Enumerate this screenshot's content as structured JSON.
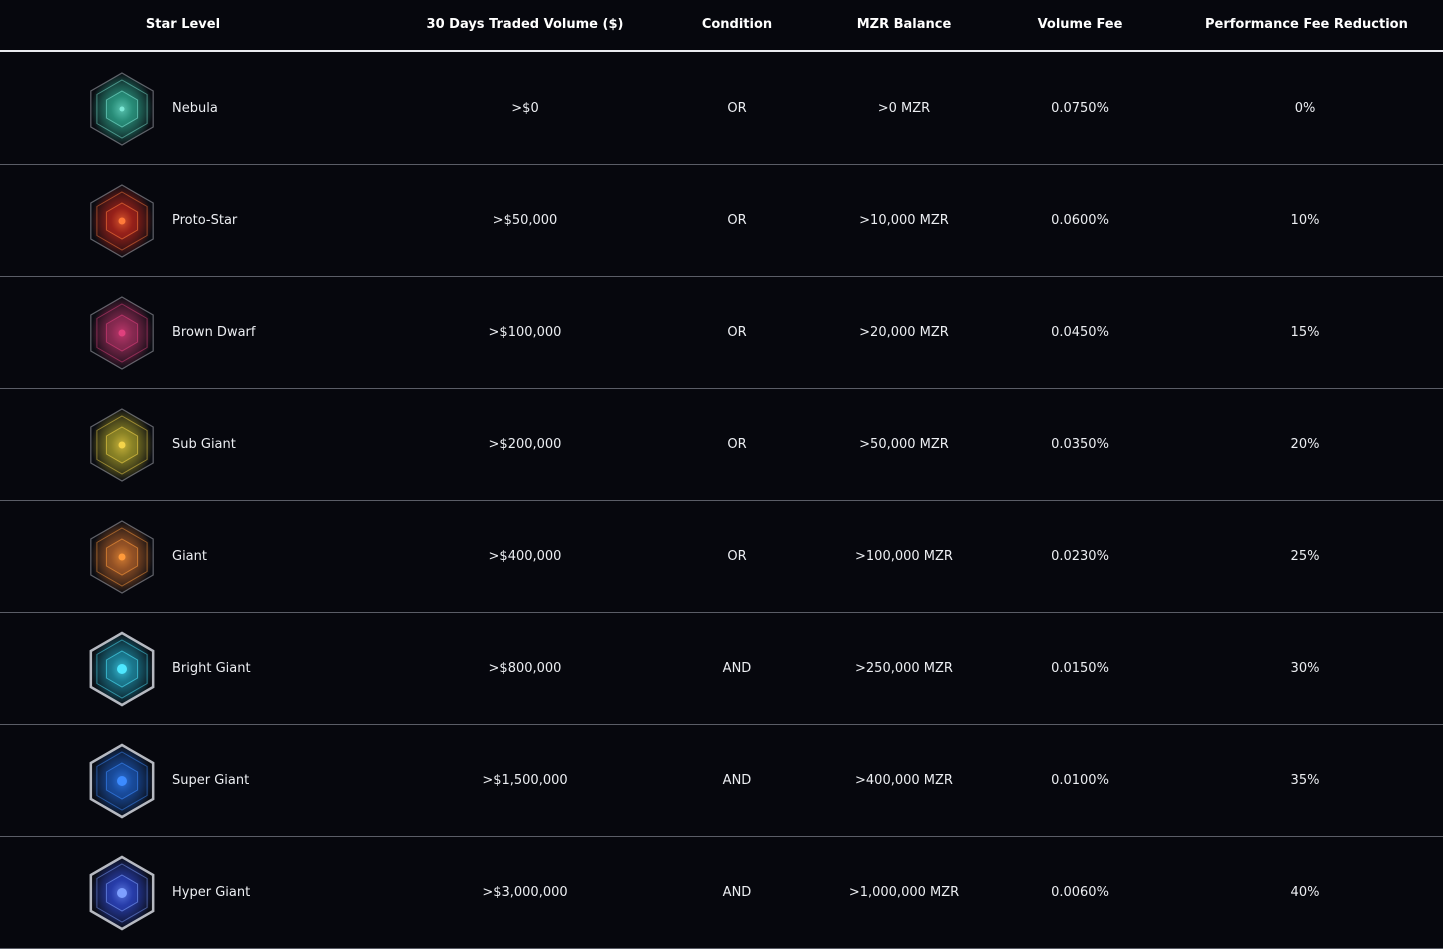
{
  "columns": {
    "star_level": "Star Level",
    "volume": "30 Days Traded Volume ($)",
    "condition": "Condition",
    "mzr_balance": "MZR Balance",
    "volume_fee": "Volume Fee",
    "perf_reduction": "Performance Fee Reduction"
  },
  "rows": [
    {
      "name": "Nebula",
      "volume": ">$0",
      "condition": "OR",
      "mzr": ">0 MZR",
      "fee": "0.0750%",
      "perf": "0%",
      "icon": "nebula-hexagon-icon",
      "color": "#2fa58c",
      "core": "#7ee8d6"
    },
    {
      "name": "Proto-Star",
      "volume": ">$50,000",
      "condition": "OR",
      "mzr": ">10,000 MZR",
      "fee": "0.0600%",
      "perf": "10%",
      "icon": "proto-star-hexagon-icon",
      "color": "#b3261c",
      "core": "#ff7a3a"
    },
    {
      "name": "Brown Dwarf",
      "volume": ">$100,000",
      "condition": "OR",
      "mzr": ">20,000 MZR",
      "fee": "0.0450%",
      "perf": "15%",
      "icon": "brown-dwarf-hexagon-icon",
      "color": "#a1305e",
      "core": "#e0407d"
    },
    {
      "name": "Sub Giant",
      "volume": ">$200,000",
      "condition": "OR",
      "mzr": ">50,000 MZR",
      "fee": "0.0350%",
      "perf": "20%",
      "icon": "sub-giant-hexagon-icon",
      "color": "#a39a2a",
      "core": "#f4d34a"
    },
    {
      "name": "Giant",
      "volume": ">$400,000",
      "condition": "OR",
      "mzr": ">100,000 MZR",
      "fee": "0.0230%",
      "perf": "25%",
      "icon": "giant-hexagon-icon",
      "color": "#b0602a",
      "core": "#ff9a3a"
    },
    {
      "name": "Bright Giant",
      "volume": ">$800,000",
      "condition": "AND",
      "mzr": ">250,000 MZR",
      "fee": "0.0150%",
      "perf": "30%",
      "icon": "bright-giant-hexagon-icon",
      "color": "#1f8fa8",
      "core": "#4ee7ff"
    },
    {
      "name": "Super Giant",
      "volume": ">$1,500,000",
      "condition": "AND",
      "mzr": ">400,000 MZR",
      "fee": "0.0100%",
      "perf": "35%",
      "icon": "super-giant-hexagon-icon",
      "color": "#1c58b8",
      "core": "#3c8bff"
    },
    {
      "name": "Hyper Giant",
      "volume": ">$3,000,000",
      "condition": "AND",
      "mzr": ">1,000,000 MZR",
      "fee": "0.0060%",
      "perf": "40%",
      "icon": "hyper-giant-hexagon-icon",
      "color": "#2e47c8",
      "core": "#7fa0ff"
    }
  ]
}
